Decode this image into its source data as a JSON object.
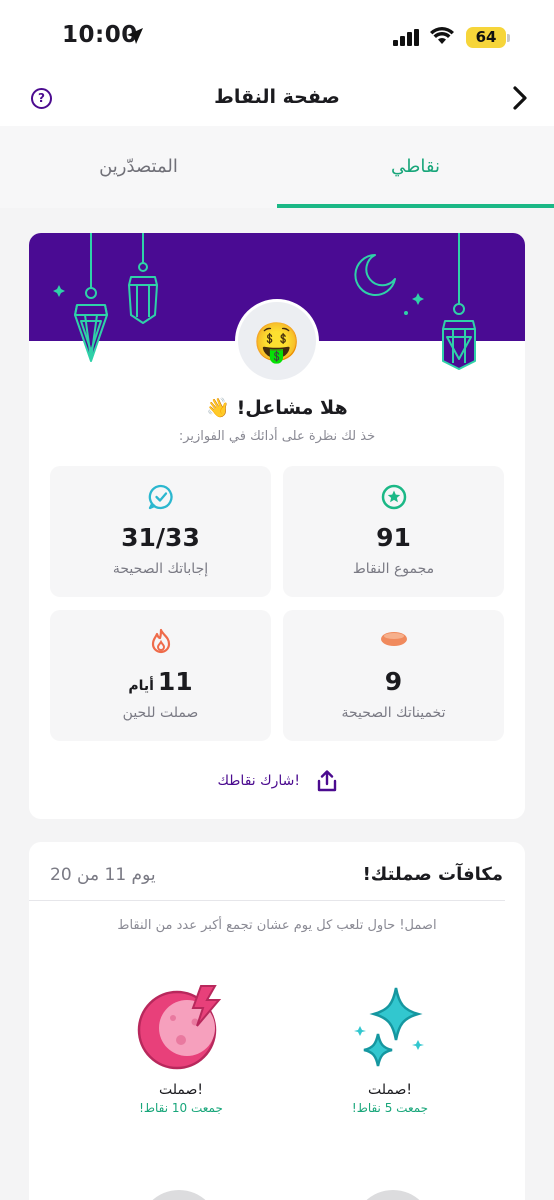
{
  "status_bar": {
    "time": "10:00",
    "battery": "64"
  },
  "header": {
    "title": "صفحة النقاط"
  },
  "tabs": [
    {
      "label": "نقاطي",
      "active": true
    },
    {
      "label": "المتصدّرين",
      "active": false
    }
  ],
  "profile": {
    "avatar_emoji": "🤑",
    "greeting": "هلا مشاعل! 👋",
    "subtitle": "خذ لك نظرة على أدائك في الفوازير:"
  },
  "stats": [
    {
      "value": "91",
      "unit": "",
      "label": "مجموع النقاط",
      "icon": "star-badge-icon"
    },
    {
      "value": "31/33",
      "unit": "",
      "label": "إجاباتك الصحيحة",
      "icon": "check-bubble-icon"
    },
    {
      "value": "9",
      "unit": "",
      "label": "تخميناتك الصحيحة",
      "icon": "date-fruit-icon"
    },
    {
      "value": "11",
      "unit": "أيام",
      "label": "صملت للحين",
      "icon": "flame-icon"
    }
  ],
  "share_label": "شارك نقاطك!",
  "rewards_card": {
    "title": "مكافآت صملتك!",
    "day_progress": "يوم 11 من 20",
    "hint": "اصمل! حاول تلعب كل يوم عشان تجمع أكبر عدد من النقاط",
    "rewards": [
      {
        "label": "صملت!",
        "sub": "جمعت 5 نقاط!",
        "icon": "sparkle-stars-icon"
      },
      {
        "label": "صملت!",
        "sub": "جمعت 10 نقاط!",
        "icon": "moon-bolt-icon"
      }
    ]
  },
  "colors": {
    "brand_purple": "#4a0b93",
    "accent_green": "#1bb886",
    "lantern_teal": "#2fd1a8"
  }
}
